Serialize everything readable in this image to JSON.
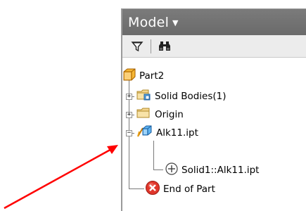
{
  "browser": {
    "title": "Model",
    "title_dropdown_icon": "caret-down-icon",
    "toolbar": {
      "filter_icon": "filter-funnel-icon",
      "find_icon": "binoculars-icon"
    },
    "tree": {
      "root": {
        "label": "Part2",
        "icon": "part-cube-icon"
      },
      "items": [
        {
          "label": "Solid Bodies(1)",
          "icon": "solid-bodies-folder-icon",
          "expander": "+"
        },
        {
          "label": "Origin",
          "icon": "folder-icon",
          "expander": "+"
        },
        {
          "label": "Alk11.ipt",
          "icon": "derived-part-icon",
          "expander": "−"
        },
        {
          "label": "Solid1::Alk11.ipt",
          "icon": "circle-plus-icon"
        },
        {
          "label": "End of Part",
          "icon": "end-of-part-icon"
        }
      ]
    }
  },
  "annotation": {
    "arrow_icon": "red-arrow-icon",
    "arrow_color": "#ff0000"
  },
  "colors": {
    "header_bg": "#737373",
    "toolbar_bg": "#ececec",
    "end_of_part_red": "#e0362b",
    "part_cube_orange": "#f2a227"
  }
}
